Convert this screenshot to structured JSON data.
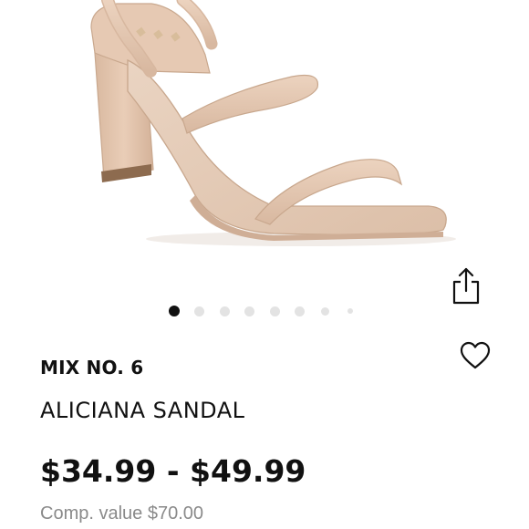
{
  "product": {
    "brand": "MIX NO. 6",
    "name": "ALICIANA SANDAL",
    "price_range": "$34.99 - $49.99",
    "comp_value": "Comp. value $70.00"
  },
  "carousel": {
    "image_count": 8,
    "active_index": 0
  },
  "icons": {
    "share": "share-icon",
    "favorite": "heart-icon"
  },
  "colors": {
    "text": "#111111",
    "muted_text": "#8a8a8a",
    "dot_active": "#111111",
    "dot_inactive": "#e3e3e3",
    "product_tone": "#e8cdb6"
  }
}
